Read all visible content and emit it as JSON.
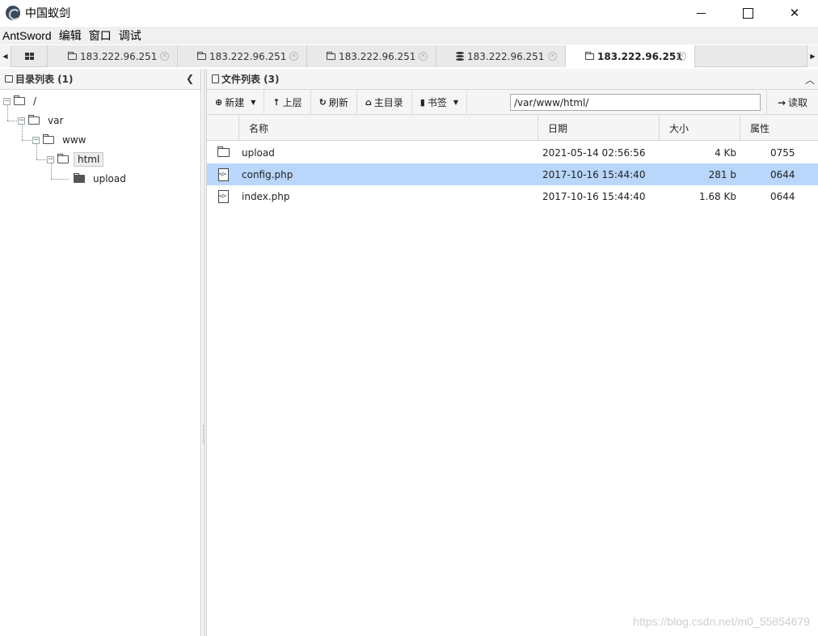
{
  "window": {
    "title": "中国蚁剑"
  },
  "menu": [
    "AntSword",
    "编辑",
    "窗口",
    "调试"
  ],
  "tabs": [
    {
      "label": "183.222.96.251",
      "icon": "folder-icon"
    },
    {
      "label": "183.222.96.251",
      "icon": "folder-icon"
    },
    {
      "label": "183.222.96.251",
      "icon": "folder-icon"
    },
    {
      "label": "183.222.96.251",
      "icon": "database-icon"
    },
    {
      "label": "183.222.96.251",
      "icon": "folder-icon",
      "active": true
    }
  ],
  "left_panel": {
    "title": "目录列表 (1)",
    "tree": [
      {
        "label": "/"
      },
      {
        "label": "var"
      },
      {
        "label": "www"
      },
      {
        "label": "html",
        "selected": true
      },
      {
        "label": "upload"
      }
    ]
  },
  "right_panel": {
    "title": "文件列表 (3)",
    "toolbar": {
      "new": "新建",
      "up": "上层",
      "refresh": "刷新",
      "home": "主目录",
      "bookmark": "书签",
      "path": "/var/www/html/",
      "read": "读取"
    },
    "columns": {
      "name": "名称",
      "date": "日期",
      "size": "大小",
      "attr": "属性"
    },
    "files": [
      {
        "type": "folder",
        "name": "upload",
        "date": "2021-05-14 02:56:56",
        "size": "4 Kb",
        "attr": "0755"
      },
      {
        "type": "php",
        "name": "config.php",
        "date": "2017-10-16 15:44:40",
        "size": "281 b",
        "attr": "0644",
        "selected": true
      },
      {
        "type": "php",
        "name": "index.php",
        "date": "2017-10-16 15:44:40",
        "size": "1.68 Kb",
        "attr": "0644"
      }
    ]
  },
  "watermark": "https://blog.csdn.net/m0_55854679"
}
